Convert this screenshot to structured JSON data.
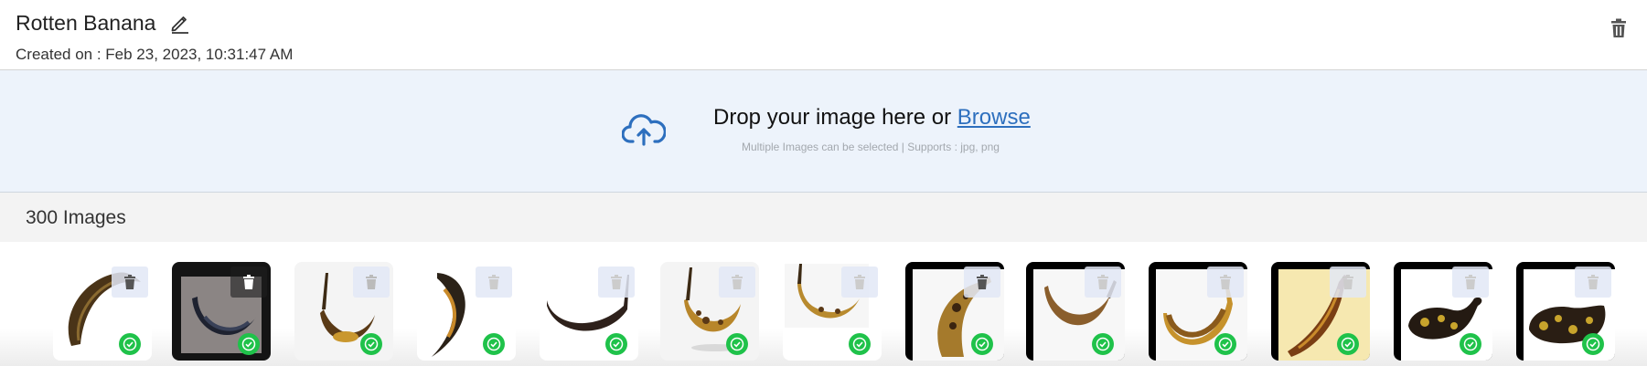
{
  "header": {
    "title": "Rotten Banana",
    "created": "Created on : Feb 23, 2023, 10:31:47 AM",
    "icons": {
      "edit": "pencil-icon",
      "delete": "trash-icon"
    }
  },
  "upload": {
    "prompt": "Drop your image here or ",
    "browse": "Browse",
    "hint": "Multiple Images can be selected | Supports : jpg, png",
    "icon": "cloud-upload-icon",
    "accent": "#2d6fbe"
  },
  "gallery": {
    "count_label": "300 Images",
    "status_color": "#1fc24a",
    "images": [
      {
        "status": "check-circle-icon"
      },
      {
        "status": "check-circle-icon"
      },
      {
        "status": "check-circle-icon"
      },
      {
        "status": "check-circle-icon"
      },
      {
        "status": "check-circle-icon"
      },
      {
        "status": "check-circle-icon"
      },
      {
        "status": "check-circle-icon"
      },
      {
        "status": "check-circle-icon"
      },
      {
        "status": "check-circle-icon"
      },
      {
        "status": "check-circle-icon"
      },
      {
        "status": "check-circle-icon"
      },
      {
        "status": "check-circle-icon"
      },
      {
        "status": "check-circle-icon"
      }
    ]
  }
}
